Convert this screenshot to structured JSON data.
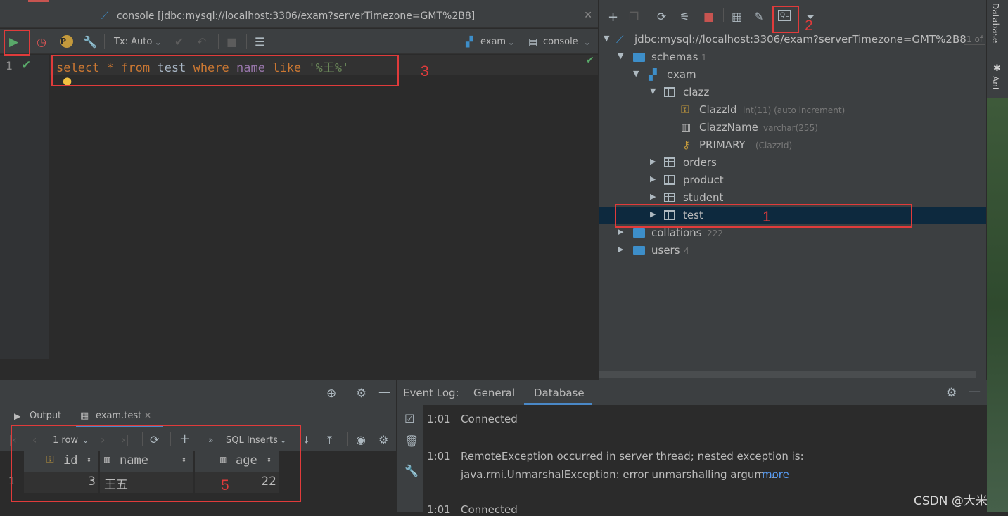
{
  "editor": {
    "title": "console [jdbc:mysql://localhost:3306/exam?serverTimezone=GMT%2B8]",
    "tx_mode": "Tx: Auto",
    "schema_selector": "exam",
    "session_selector": "console",
    "line_number": "1",
    "sql": {
      "t1": "select",
      "t2": "*",
      "t3": "from",
      "t4": "test",
      "t5": "where",
      "t6": "name",
      "t7": "like",
      "t8": "'%王%'"
    }
  },
  "annotations": {
    "a1": "1",
    "a2": "2",
    "a3": "3",
    "a5": "5"
  },
  "database_tree": {
    "connection": "jdbc:mysql://localhost:3306/exam?serverTimezone=GMT%2B8",
    "connection_count": "1 of",
    "schemas": {
      "label": "schemas",
      "count": "1"
    },
    "exam": "exam",
    "clazz": "clazz",
    "columns": [
      {
        "name": "ClazzId",
        "type": "int(11) (auto increment)"
      },
      {
        "name": "ClazzName",
        "type": "varchar(255)"
      }
    ],
    "primary": {
      "name": "PRIMARY",
      "detail": "(ClazzId)"
    },
    "tables": [
      "orders",
      "product",
      "student",
      "test"
    ],
    "collations": {
      "label": "collations",
      "count": "222"
    },
    "users": {
      "label": "users",
      "count": "4"
    }
  },
  "side_strip": {
    "database_tab": "Database",
    "ant_tab": "Ant"
  },
  "run_pane": {
    "tabs": [
      "Output",
      "exam.test"
    ],
    "row_selector": "1 row",
    "export_format": "SQL Inserts",
    "columns": [
      "id",
      "name",
      "age"
    ],
    "row_number": "1",
    "row": {
      "id": "3",
      "name": "王五",
      "age": "22"
    }
  },
  "event_log": {
    "label": "Event Log:",
    "tabs": [
      "General",
      "Database"
    ],
    "entries": [
      {
        "time": "1:01",
        "text": "Connected"
      },
      {
        "time": "1:01",
        "text": "RemoteException occurred in server thread; nested exception is:",
        "text2": "java.rmi.UnmarshalException: error unmarshalling argum ...",
        "link": "more"
      },
      {
        "time": "1:01",
        "text": "Connected"
      }
    ]
  },
  "watermark": "CSDN @大米"
}
